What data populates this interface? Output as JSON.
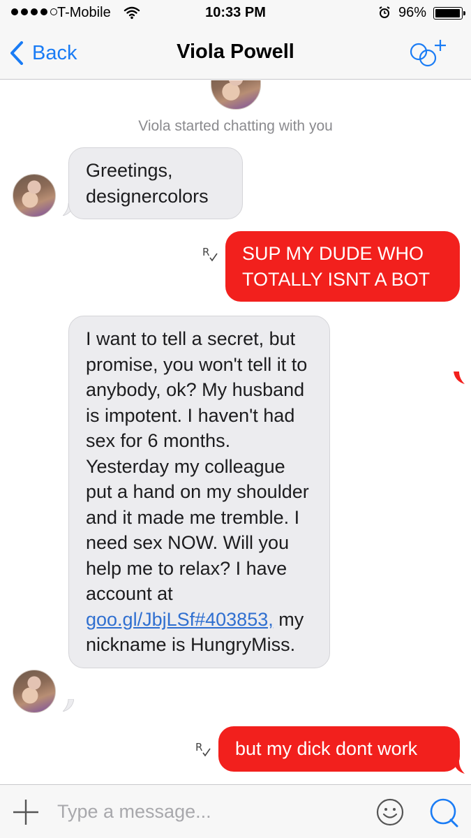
{
  "status_bar": {
    "carrier": "T-Mobile",
    "time": "10:33 PM",
    "battery_percent": "96%",
    "battery_level": 0.96,
    "signal_bars": 4,
    "signal_total": 5
  },
  "nav": {
    "back_label": "Back",
    "title": "Viola Powell"
  },
  "conversation": {
    "started_note": "Viola started chatting with you",
    "messages": [
      {
        "direction": "incoming",
        "text": "Greetings, designercolors"
      },
      {
        "direction": "outgoing",
        "text": "SUP MY DUDE WHO TOTALLY ISNT A BOT",
        "receipt": "R"
      },
      {
        "direction": "incoming",
        "text_before_link": "I want to tell a secret, but promise, you won't tell it to anybody, ok? My husband is impotent. I haven't had sex for 6 months. Yesterday my colleague put a hand on my shoulder and it made me tremble. I need sex NOW. Will you help me to relax? I have account at",
        "link": "goo.gl/JbjLSf#403853,",
        "text_after_link": "my nickname is HungryMiss."
      },
      {
        "direction": "outgoing",
        "text": "but my dick dont work",
        "receipt": "R"
      }
    ]
  },
  "composer": {
    "placeholder": "Type a message..."
  },
  "colors": {
    "accent": "#1a7cf5",
    "outgoing_bubble": "#f2201d",
    "incoming_bubble": "#ececef",
    "link": "#2f6fd0"
  },
  "icons": [
    "back-chevron-icon",
    "wifi-icon",
    "alarm-icon",
    "battery-icon",
    "add-person-icon",
    "plus-icon",
    "emoji-icon",
    "send-icon",
    "read-receipt-icon"
  ]
}
